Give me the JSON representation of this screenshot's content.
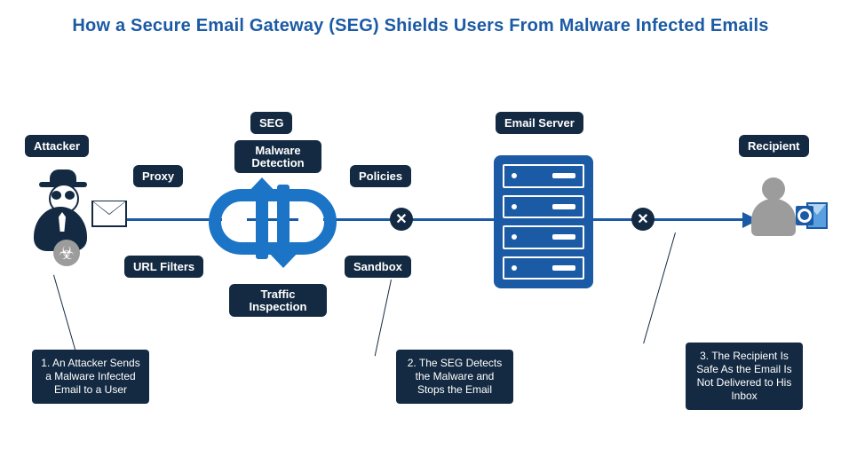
{
  "title": "How a Secure Email Gateway (SEG) Shields Users From Malware Infected Emails",
  "labels": {
    "attacker": "Attacker",
    "seg": "SEG",
    "malware_detection": "Malware\nDetection",
    "proxy": "Proxy",
    "url_filters": "URL Filters",
    "traffic_inspection": "Traffic\nInspection",
    "policies": "Policies",
    "sandbox": "Sandbox",
    "email_server": "Email Server",
    "recipient": "Recipient"
  },
  "callouts": {
    "step1": "1. An Attacker Sends a Malware Infected Email to a User",
    "step2": "2. The SEG Detects the Malware and Stops the Email",
    "step3": "3. The Recipient Is Safe As the Email Is Not Delivered to His Inbox"
  },
  "block_icons": {
    "x": "✕"
  },
  "icons": {
    "attacker": "attacker-icon",
    "biohazard": "biohazard-icon",
    "envelope": "envelope-icon",
    "seg": "seg-gateway-icon",
    "server": "email-server-icon",
    "recipient": "person-icon",
    "outlook": "outlook-icon"
  }
}
